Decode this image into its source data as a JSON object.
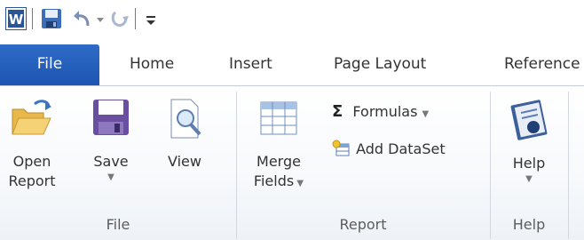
{
  "quick_access": {
    "app_icon": "word-icon",
    "save_icon": "save-icon",
    "undo_icon": "undo-icon",
    "redo_icon": "redo-icon",
    "customize_icon": "customize-qat-icon"
  },
  "tabs": [
    {
      "label": "File",
      "active": true
    },
    {
      "label": "Home"
    },
    {
      "label": "Insert"
    },
    {
      "label": "Page Layout"
    },
    {
      "label": "Reference"
    }
  ],
  "groups": {
    "file": {
      "label": "File",
      "open_line1": "Open",
      "open_line2": "Report",
      "save_label": "Save",
      "view_label": "View"
    },
    "report": {
      "label": "Report",
      "merge_line1": "Merge",
      "merge_line2": "Fields",
      "formulas_label": "Formulas",
      "add_dataset_label": "Add DataSet"
    },
    "help": {
      "label": "Help",
      "help_label": "Help"
    }
  },
  "colors": {
    "file_tab": "#2e6bc6",
    "accent": "#1d55b3"
  }
}
